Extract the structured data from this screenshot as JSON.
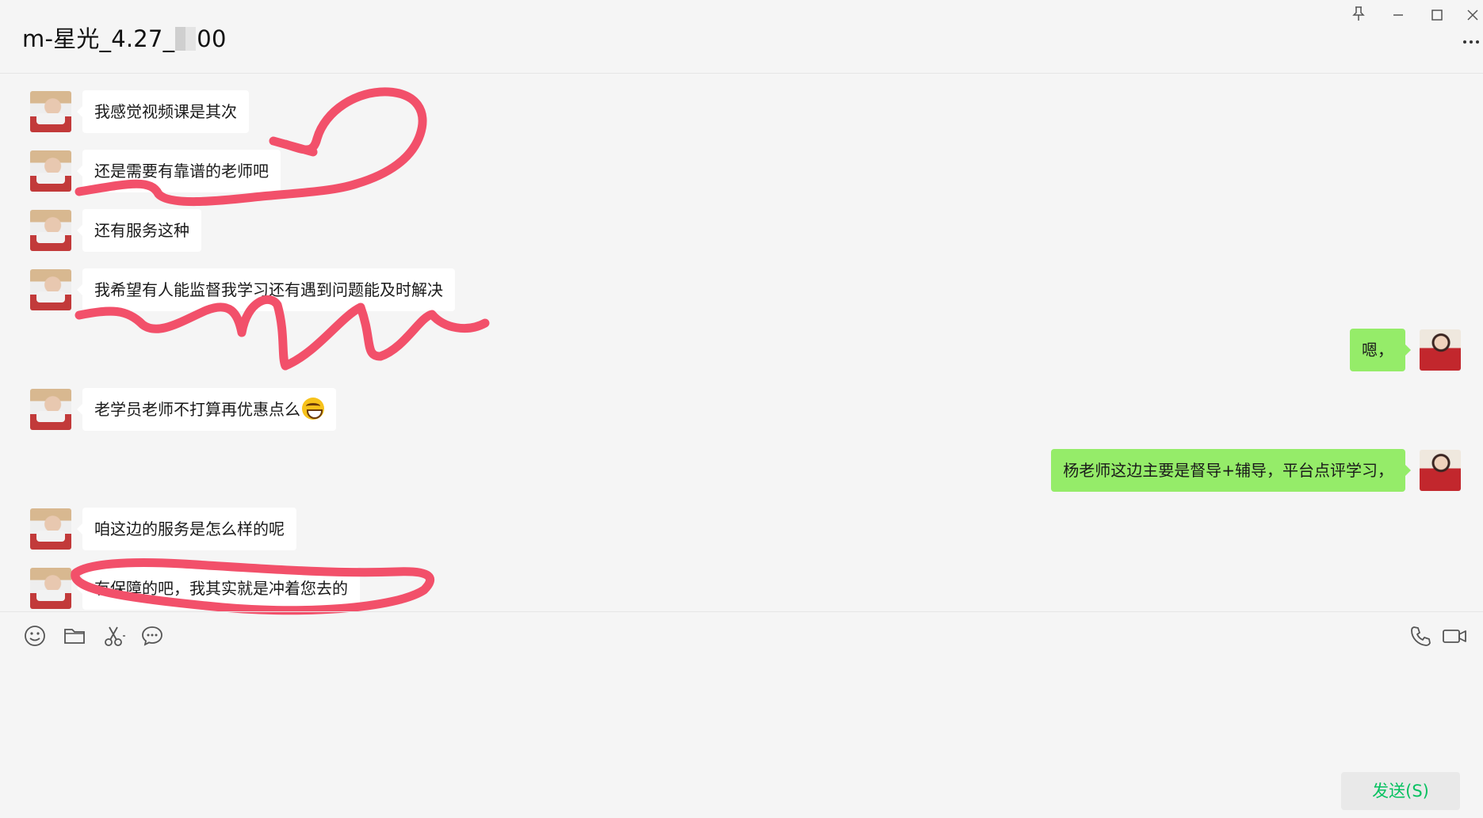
{
  "window": {
    "title_prefix": "m-星光_4.27_",
    "title_suffix": "00",
    "buttons": [
      "pin",
      "minimize",
      "maximize",
      "close",
      "more"
    ]
  },
  "messages": [
    {
      "side": "left",
      "text": "我感觉视频课是其次"
    },
    {
      "side": "left",
      "text": "还是需要有靠谱的老师吧"
    },
    {
      "side": "left",
      "text": "还有服务这种"
    },
    {
      "side": "left",
      "text": "我希望有人能监督我学习还有遇到问题能及时解决"
    },
    {
      "side": "right",
      "text": "嗯，"
    },
    {
      "side": "left",
      "text": "老学员老师不打算再优惠点么",
      "emoji": "grinning-face"
    },
    {
      "side": "right",
      "text": "杨老师这边主要是督导+辅导，平台点评学习，"
    },
    {
      "side": "left",
      "text": "咱这边的服务是怎么样的呢"
    },
    {
      "side": "left",
      "text": "有保障的吧，我其实就是冲着您去的"
    }
  ],
  "toolbar": {
    "icons": [
      "emoji-icon",
      "folder-icon",
      "scissors-icon",
      "chat-history-icon",
      "phone-icon",
      "video-call-icon"
    ]
  },
  "input": {
    "value": ""
  },
  "send_button": {
    "label": "发送(S)"
  },
  "colors": {
    "background": "#f5f5f5",
    "incoming_bubble": "#ffffff",
    "outgoing_bubble": "#95ec69",
    "send_text": "#07c160",
    "annotation_stroke": "#f2506a"
  }
}
